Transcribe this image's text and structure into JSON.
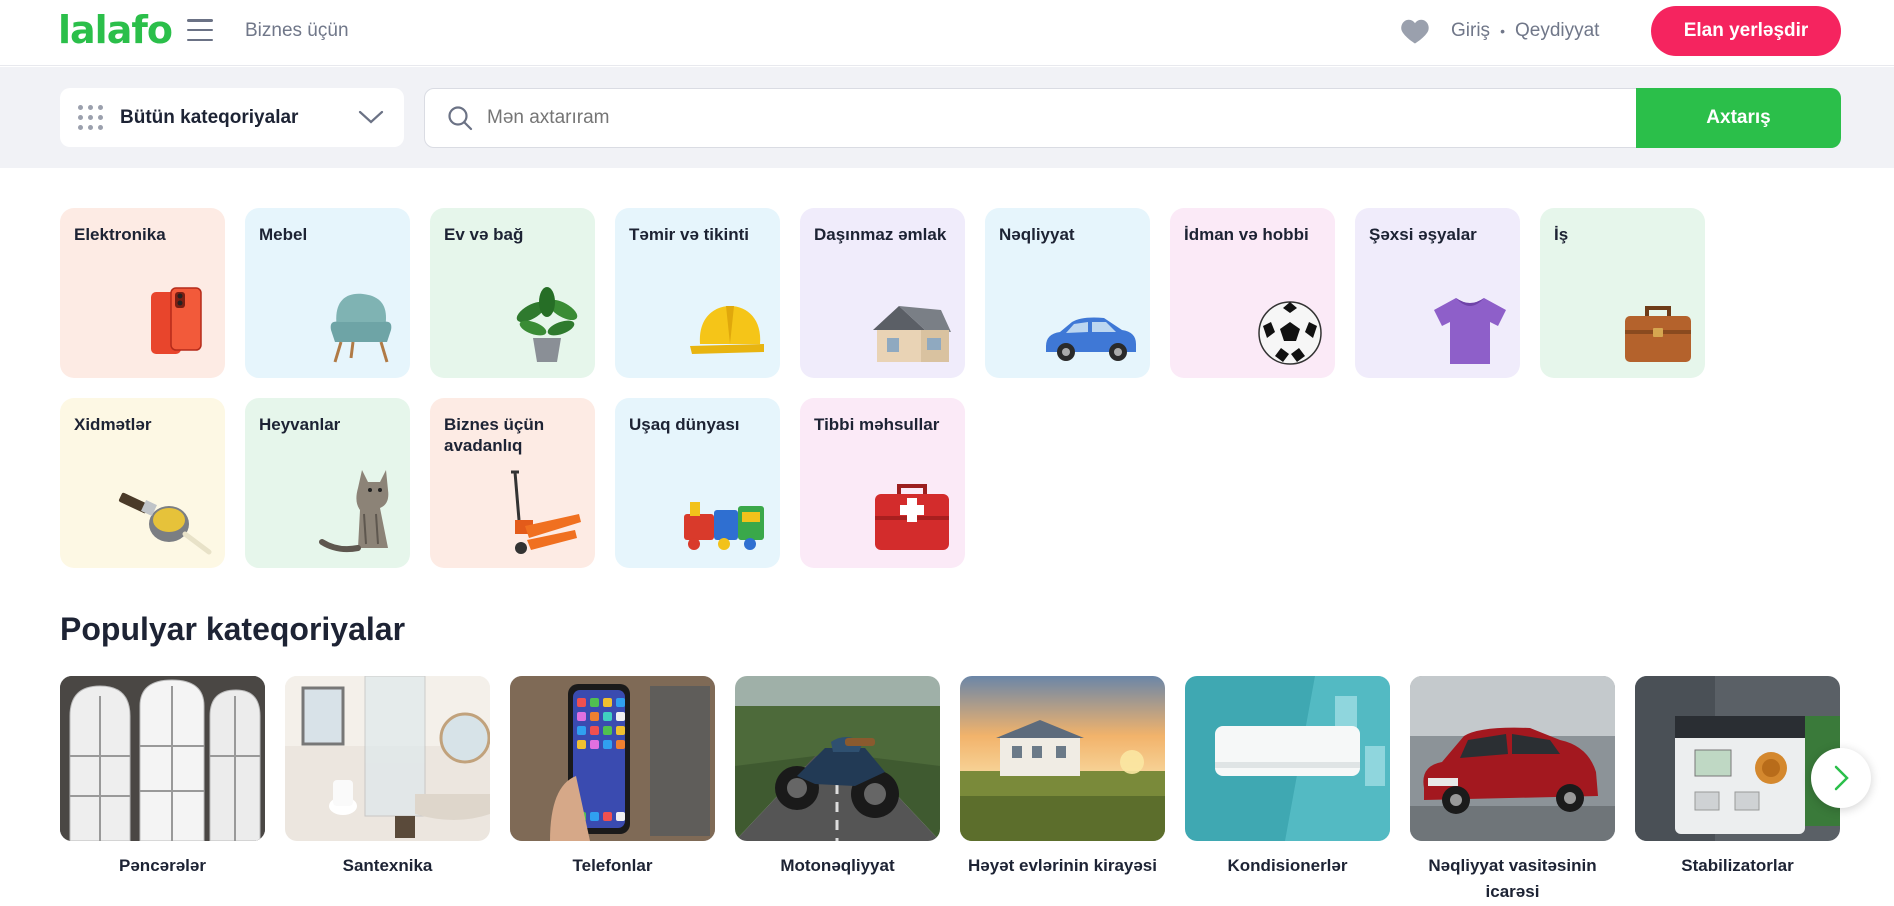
{
  "header": {
    "logo": "lalafo",
    "business_link": "Biznes üçün",
    "login": "Giriş",
    "separator": "•",
    "register": "Qeydiyyat",
    "post_ad": "Elan yerləşdir",
    "colors": {
      "brand_green": "#2bbf4a",
      "accent_pink": "#f5245f"
    }
  },
  "search": {
    "category_select": "Bütün kateqoriyalar",
    "placeholder": "Mən axtarıram",
    "button": "Axtarış"
  },
  "categories": [
    {
      "label": "Elektronika",
      "icon": "smartphone-icon",
      "bg": "#fdebe4"
    },
    {
      "label": "Mebel",
      "icon": "armchair-icon",
      "bg": "#e6f5fc"
    },
    {
      "label": "Ev və bağ",
      "icon": "house-plant-icon",
      "bg": "#e6f6eb"
    },
    {
      "label": "Təmir və tikinti",
      "icon": "hard-hat-icon",
      "bg": "#e6f5fc"
    },
    {
      "label": "Daşınmaz əmlak",
      "icon": "house-icon",
      "bg": "#f0ecfb"
    },
    {
      "label": "Nəqliyyat",
      "icon": "car-icon",
      "bg": "#e6f5fc"
    },
    {
      "label": "İdman və hobbi",
      "icon": "soccer-ball-icon",
      "bg": "#fbeaf7"
    },
    {
      "label": "Şəxsi əşyalar",
      "icon": "t-shirt-icon",
      "bg": "#f0ecfb"
    },
    {
      "label": "İş",
      "icon": "briefcase-icon",
      "bg": "#e6f6eb"
    },
    {
      "label": "Xidmətlər",
      "icon": "paint-brush-icon",
      "bg": "#fdf8e4"
    },
    {
      "label": "Heyvanlar",
      "icon": "cat-icon",
      "bg": "#e6f6eb"
    },
    {
      "label": "Biznes üçün avadanlıq",
      "icon": "pallet-jack-icon",
      "bg": "#fdebe4"
    },
    {
      "label": "Uşaq dünyası",
      "icon": "toy-train-icon",
      "bg": "#e6f5fc"
    },
    {
      "label": "Tibbi məhsullar",
      "icon": "first-aid-kit-icon",
      "bg": "#fbeaf7"
    }
  ],
  "popular": {
    "title": "Populyar kateqoriyalar",
    "items": [
      {
        "label": "Pəncərələr",
        "image": "windows-image"
      },
      {
        "label": "Santexnika",
        "image": "bathroom-image"
      },
      {
        "label": "Telefonlar",
        "image": "phone-image"
      },
      {
        "label": "Motonəqliyyat",
        "image": "motorcycle-image"
      },
      {
        "label": "Həyət evlərinin kirayəsi",
        "image": "country-house-image"
      },
      {
        "label": "Kondisionerlər",
        "image": "air-conditioner-image"
      },
      {
        "label": "Nəqliyyat vasitəsinin icarəsi",
        "image": "red-car-image"
      },
      {
        "label": "Stabilizatorlar",
        "image": "voltage-stabilizer-image"
      }
    ]
  }
}
